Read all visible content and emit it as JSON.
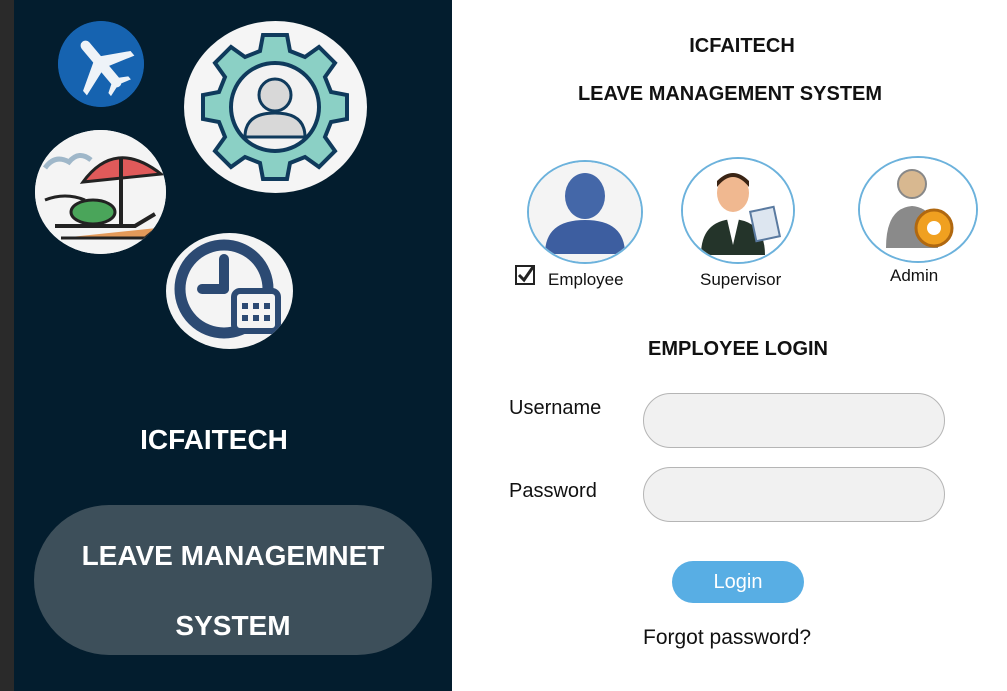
{
  "left": {
    "brand": "ICFAITECH",
    "tagline_line1": "LEAVE MANAGEMNET",
    "tagline_line2": "SYSTEM",
    "icons": [
      "airplane-icon",
      "user-gear-icon",
      "beach-umbrella-icon",
      "clock-calendar-icon"
    ]
  },
  "right": {
    "brand": "ICFAITECH",
    "system_title": "LEAVE MANAGEMENT SYSTEM",
    "roles": [
      {
        "label": "Employee",
        "icon": "employee-avatar-icon",
        "selected": true
      },
      {
        "label": "Supervisor",
        "icon": "supervisor-avatar-icon",
        "selected": false
      },
      {
        "label": "Admin",
        "icon": "admin-gear-icon",
        "selected": false
      }
    ],
    "login_heading": "EMPLOYEE LOGIN",
    "username_label": "Username",
    "username_value": "",
    "password_label": "Password",
    "password_value": "",
    "login_button": "Login",
    "forgot_link": "Forgot password?"
  },
  "colors": {
    "left_bg": "#031d2e",
    "pill_bg": "#3d4f5a",
    "accent_blue": "#58aee4",
    "role_border": "#6cb2dc"
  }
}
